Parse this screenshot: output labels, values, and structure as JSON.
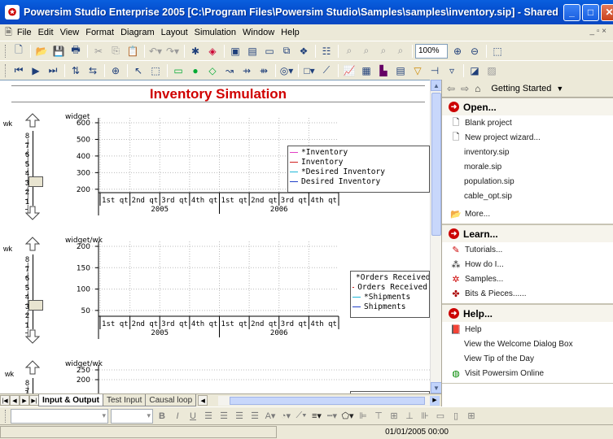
{
  "title_bar": {
    "title": "Powersim Studio Enterprise 2005 [C:\\Program Files\\Powersim Studio\\Samples\\samples\\inventory.sip] - Shared Diagrams"
  },
  "menu": [
    "File",
    "Edit",
    "View",
    "Format",
    "Diagram",
    "Layout",
    "Simulation",
    "Window",
    "Help"
  ],
  "toolbar": {
    "zoom": "100%"
  },
  "canvas": {
    "title": "Inventory Simulation"
  },
  "sliders": [
    {
      "unit": "wk",
      "ticks": [
        "8",
        "7",
        "6",
        "5",
        "4",
        "3",
        "2",
        "1"
      ],
      "level": 3
    },
    {
      "unit": "wk",
      "ticks": [
        "8",
        "7",
        "6",
        "5",
        "4",
        "3",
        "2",
        "1"
      ],
      "level": 3
    },
    {
      "unit": "wk",
      "ticks": [
        "8",
        "7"
      ],
      "level": null
    }
  ],
  "chart_data": [
    {
      "type": "line",
      "ylabel": "widget",
      "yticks": [
        "600",
        "500",
        "400",
        "300",
        "200"
      ],
      "ylim": [
        150,
        600
      ],
      "categories": [
        "1st qt",
        "2nd qt",
        "3rd qt",
        "4th qt",
        "1st qt",
        "2nd qt",
        "3rd qt",
        "4th qt"
      ],
      "years": [
        "2005",
        "2006"
      ],
      "series": [
        {
          "name": "*Inventory",
          "color": "#e23ec4",
          "values": []
        },
        {
          "name": "Inventory",
          "color": "#d02020",
          "values": []
        },
        {
          "name": "*Desired Inventory",
          "color": "#20b8d8",
          "values": []
        },
        {
          "name": "Desired Inventory",
          "color": "#2040c8",
          "values": []
        }
      ],
      "grid": true,
      "legend": "right"
    },
    {
      "type": "line",
      "ylabel": "widget/wk",
      "yticks": [
        "200",
        "150",
        "100",
        "50"
      ],
      "ylim": [
        25,
        225
      ],
      "categories": [
        "1st qt",
        "2nd qt",
        "3rd qt",
        "4th qt",
        "1st qt",
        "2nd qt",
        "3rd qt",
        "4th qt"
      ],
      "years": [
        "2005",
        "2006"
      ],
      "series": [
        {
          "name": "*Orders Received",
          "color": "#e23ec4",
          "values": []
        },
        {
          "name": "Orders Received",
          "color": "#d02020",
          "values": []
        },
        {
          "name": "*Shipments",
          "color": "#20b8d8",
          "values": []
        },
        {
          "name": "Shipments",
          "color": "#2040c8",
          "values": []
        }
      ],
      "grid": true,
      "legend": "right"
    },
    {
      "type": "line",
      "ylabel": "widget/wk",
      "yticks": [
        "250",
        "200"
      ],
      "series": [],
      "grid": true
    }
  ],
  "sheet_tabs": [
    "Input & Output",
    "Test Input",
    "Causal loop"
  ],
  "task_pane": {
    "nav_title": "Getting Started",
    "open": {
      "title": "Open...",
      "blank": "Blank project",
      "wizard": "New project wizard...",
      "files": [
        "inventory.sip",
        "morale.sip",
        "population.sip",
        "cable_opt.sip"
      ],
      "more": "More..."
    },
    "learn": {
      "title": "Learn...",
      "items": [
        "Tutorials...",
        "How do I...",
        "Samples...",
        "Bits & Pieces......"
      ]
    },
    "help": {
      "title": "Help...",
      "items": [
        "Help",
        "View the Welcome Dialog Box",
        "View Tip of the Day",
        "Visit Powersim Online"
      ]
    }
  },
  "status": {
    "time": "01/01/2005 00:00"
  },
  "colors": {
    "title_red": "#d00000",
    "titlebar_blue": "#0550d0"
  }
}
